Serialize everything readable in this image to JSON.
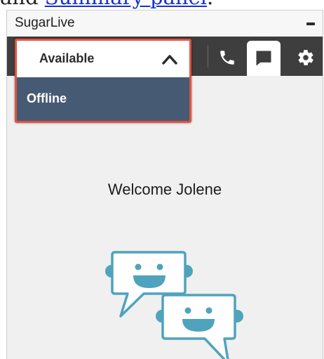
{
  "document_crop": {
    "prefix": "and ",
    "link_text": "Summary panel",
    "suffix": "."
  },
  "panel": {
    "title": "SugarLive",
    "minimize_icon": "minimize-icon"
  },
  "toolbar": {
    "buttons": [
      {
        "name": "phone",
        "icon": "phone-icon",
        "active": false
      },
      {
        "name": "chat",
        "icon": "chat-icon",
        "active": true
      },
      {
        "name": "settings",
        "icon": "gear-icon",
        "active": false
      }
    ]
  },
  "status": {
    "selected": "Available",
    "expanded": true,
    "options": [
      "Offline"
    ],
    "highlight_color": "#e2533f",
    "option_bg": "#475a74"
  },
  "main": {
    "welcome": "Welcome Jolene",
    "illustration": "chat-bubbles-illustration",
    "accent_color": "#4fa3bd"
  }
}
